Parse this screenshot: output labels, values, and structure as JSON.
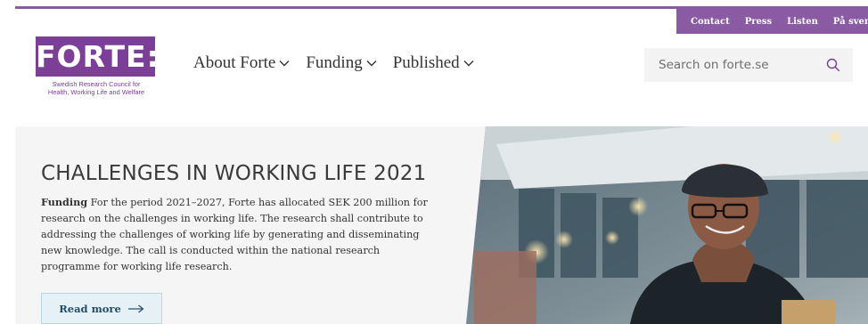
{
  "utility_nav": [
    "Contact",
    "Press",
    "Listen",
    "På svenska"
  ],
  "logo": {
    "wordmark": "FORTE:",
    "subtitle_line1": "Swedish Research Council for",
    "subtitle_line2": "Health, Working Life and Welfare"
  },
  "main_nav": [
    "About Forte",
    "Funding",
    "Published"
  ],
  "search": {
    "placeholder": "Search on forte.se"
  },
  "hero": {
    "title": "CHALLENGES IN WORKING LIFE 2021",
    "category": "Funding",
    "body": "For the period 2021–2027, Forte has allocated SEK 200 million for research on the challenges in working life. The research shall contribute to addressing the challenges of working life by generating and disseminating new knowledge. The call is conducted within the national research programme for working life research.",
    "cta": "Read more"
  },
  "colors": {
    "brand_purple": "#7b3f98",
    "utility_purple": "#8a5ba3",
    "cta_bg": "#e6f1f5",
    "cta_text": "#1f4d6b"
  },
  "icons": {
    "nav_chevron": "chevron-down-icon",
    "search": "search-icon",
    "cta_arrow": "arrow-right-icon"
  }
}
